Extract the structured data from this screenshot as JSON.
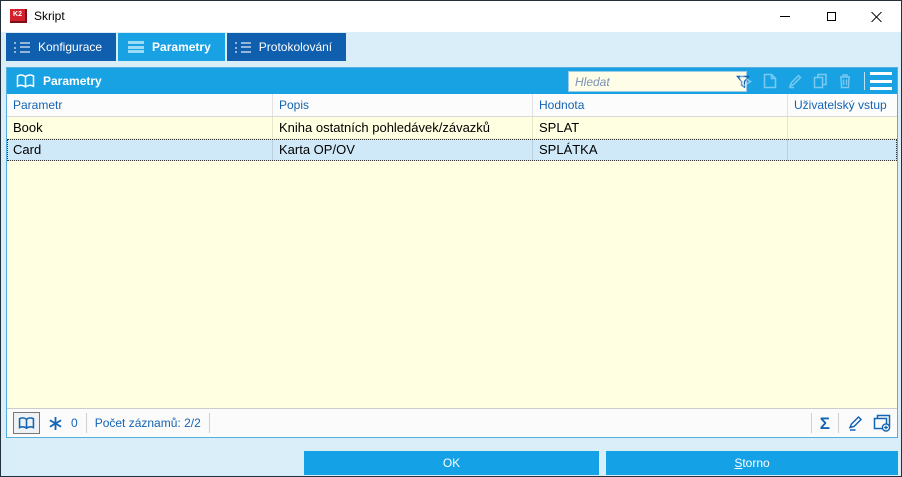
{
  "window": {
    "title": "Skript"
  },
  "tabs": [
    {
      "label": "Konfigurace",
      "active": false
    },
    {
      "label": "Parametry",
      "active": true
    },
    {
      "label": "Protokolování",
      "active": false
    }
  ],
  "panel": {
    "title": "Parametry",
    "search_placeholder": "Hledat"
  },
  "table": {
    "columns": [
      "Parametr",
      "Popis",
      "Hodnota",
      "Uživatelský vstup"
    ],
    "rows": [
      {
        "parametr": "Book",
        "popis": "Kniha ostatních pohledávek/závazků",
        "hodnota": "SPLAT",
        "vstup": ""
      },
      {
        "parametr": "Card",
        "popis": "Karta OP/OV",
        "hodnota": "SPLÁTKA",
        "vstup": ""
      }
    ],
    "selected_row_index": 1
  },
  "status": {
    "flake_count": "0",
    "records_label": "Počet záznamů: 2/2",
    "sigma_glyph": "Σ"
  },
  "footer": {
    "ok_label": "OK",
    "storno_accel": "S",
    "storno_rest": "torno"
  },
  "colors": {
    "accent_blue": "#18a2e4",
    "tab_inactive_blue": "#0f5fae",
    "table_bg_cream": "#ffffe1",
    "selected_row_blue": "#cfe9f8",
    "header_text_blue": "#1464b4",
    "dialog_bg_blue": "#d9eef9",
    "app_icon_red": "#d41f2c"
  }
}
